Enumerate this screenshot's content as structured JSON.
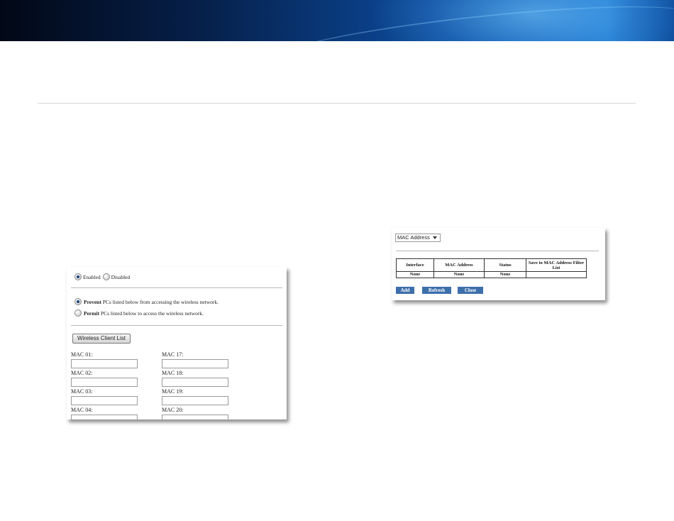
{
  "enable_section": {
    "enabled_label": "Enabled",
    "disabled_label": "Disabled",
    "selected": "Enabled"
  },
  "access_mode": {
    "prevent_bold": "Prevent",
    "prevent_rest": " PCs listed below from accessing the wireless network.",
    "permit_bold": "Permit",
    "permit_rest": " PCs listed below to access the wireless network.",
    "selected": "Prevent"
  },
  "wireless_client_list_button": "Wireless Client List",
  "mac_fields": {
    "left": [
      {
        "label": "MAC 01:",
        "value": ""
      },
      {
        "label": "MAC 02:",
        "value": ""
      },
      {
        "label": "MAC 03:",
        "value": ""
      },
      {
        "label": "MAC 04:",
        "value": ""
      }
    ],
    "right": [
      {
        "label": "MAC 17:",
        "value": ""
      },
      {
        "label": "MAC 18:",
        "value": ""
      },
      {
        "label": "MAC 19:",
        "value": ""
      },
      {
        "label": "MAC 20:",
        "value": ""
      }
    ]
  },
  "client_list": {
    "sort_select": "MAC Address",
    "headers": [
      "Interface",
      "MAC Address",
      "Status",
      "Save to MAC Address Filter List"
    ],
    "rows": [
      [
        "None",
        "None",
        "None",
        ""
      ]
    ],
    "buttons": {
      "add": "Add",
      "refresh": "Refresh",
      "close": "Close"
    }
  },
  "colors": {
    "button_blue": "#3d6fab",
    "banner_dark": "#020816",
    "banner_light": "#2a86d6"
  }
}
